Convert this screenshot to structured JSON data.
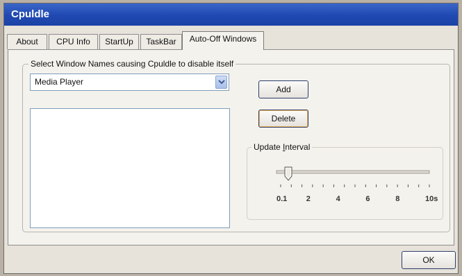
{
  "window": {
    "title": "Cpuldle"
  },
  "tabs": [
    {
      "label": "About"
    },
    {
      "label": "CPU Info"
    },
    {
      "label": "StartUp"
    },
    {
      "label": "TaskBar"
    },
    {
      "label": "Auto-Off Windows",
      "active": true
    }
  ],
  "window_names": {
    "group_label": "Select Window Names causing Cpuldle to disable itself",
    "combo_value": "Media Player",
    "add_label": "Add",
    "delete_label": "Delete",
    "list_items": []
  },
  "update_interval": {
    "group_label_pre": "Update ",
    "group_label_key": "I",
    "group_label_post": "nterval",
    "tick_labels": [
      "0.1",
      "2",
      "4",
      "6",
      "8",
      "10s"
    ],
    "value_seconds": 0.5
  },
  "footer": {
    "ok_label": "OK"
  },
  "colors": {
    "title_bar": "#1f49b1",
    "default_button_outline": "#f0b45a"
  }
}
